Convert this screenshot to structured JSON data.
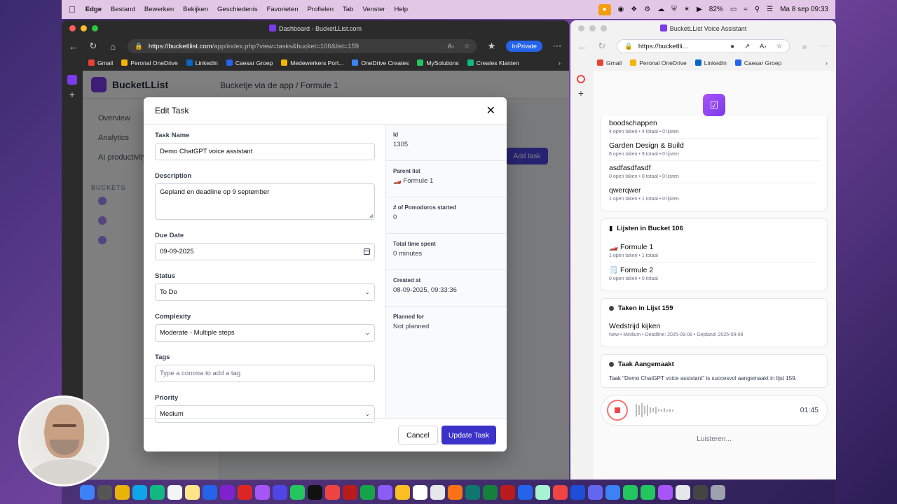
{
  "menubar": {
    "app": "Edge",
    "items": [
      "Bestand",
      "Bewerken",
      "Bekijken",
      "Geschiedenis",
      "Favorieten",
      "Profielen",
      "Tab",
      "Venster",
      "Help"
    ],
    "battery": "82%",
    "clock": "Ma 8 sep  09:33"
  },
  "left_browser": {
    "window_title": "Dashboard - BucketLList.com",
    "url_host": "https://bucketllist.com",
    "url_path": "/app/index.php?view=tasks&bucket=106&list=159",
    "inprivate": "InPrivate",
    "bookmarks": [
      "Gmail",
      "Peronal OneDrive",
      "LinkedIn",
      "Caesar Groep",
      "Medewerkers Port...",
      "OneDrive Creates",
      "MySolutions",
      "Creates Klanten"
    ]
  },
  "app_page": {
    "brand": "BucketLList",
    "breadcrumb": "Bucketje via de app  /  Formule 1",
    "side_items": [
      "Overview",
      "Analytics",
      "AI productivity"
    ],
    "buckets_header": "BUCKETS",
    "add_task": "Add task"
  },
  "modal": {
    "title": "Edit Task",
    "task_name_label": "Task Name",
    "task_name_value": "Demo ChatGPT voice assistant",
    "description_label": "Description",
    "description_value": "Gepland en deadline op 9 september",
    "due_date_label": "Due Date",
    "due_date_value": "09-09-2025",
    "status_label": "Status",
    "status_value": "To Do",
    "complexity_label": "Complexity",
    "complexity_value": "Moderate - Multiple steps",
    "tags_label": "Tags",
    "tags_placeholder": "Type a comma to add a tag",
    "priority_label": "Priority",
    "priority_value": "Medium",
    "info": [
      {
        "key": "Id",
        "value": "1305"
      },
      {
        "key": "Parent list",
        "value": "🏎️ Formule 1"
      },
      {
        "key": "# of Pomodoros started",
        "value": "0"
      },
      {
        "key": "Total time spent",
        "value": "0 minutes"
      },
      {
        "key": "Created at",
        "value": "08-09-2025, 09:33:36"
      },
      {
        "key": "Planned for",
        "value": "Not planned"
      }
    ],
    "cancel_label": "Cancel",
    "update_label": "Update Task"
  },
  "right_browser": {
    "window_title": "BucketLList Voice Assistant",
    "url_host": "https://bucketlli...",
    "bookmarks": [
      "Gmail",
      "Peronal OneDrive",
      "LinkedIn",
      "Caesar Groep"
    ],
    "lists": [
      {
        "name": "boodschappen",
        "meta": "4 open taken • 4 totaal • 0 lijsten"
      },
      {
        "name": "Garden Design & Build",
        "meta": "8 open taken • 9 totaal • 0 lijsten"
      },
      {
        "name": "asdfasdfasdf",
        "meta": "0 open taken • 0 totaal • 0 lijsten"
      },
      {
        "name": "qwerqwer",
        "meta": "1 open taken • 1 totaal • 0 lijsten"
      }
    ],
    "bucket_card": {
      "title": "Lijsten in Bucket 106",
      "items": [
        {
          "name": "🏎️ Formule 1",
          "meta": "1 open taken • 1 totaal"
        },
        {
          "name": "🗒️ Formule 2",
          "meta": "0 open taken • 0 totaal"
        }
      ]
    },
    "tasks_card": {
      "title": "Taken in Lijst 159",
      "items": [
        {
          "name": "Wedstrijd kijken",
          "meta": "New • Medium • Deadline: 2025-09-08 • Gepland: 2025-09-08"
        }
      ]
    },
    "created_card": {
      "title": "Taak Aangemaakt",
      "message": "Taak \"Demo ChatGPT voice assistant\" is succesvol aangemaakt in lijst 159."
    },
    "timer": "01:45",
    "listening": "Luisteren..."
  }
}
